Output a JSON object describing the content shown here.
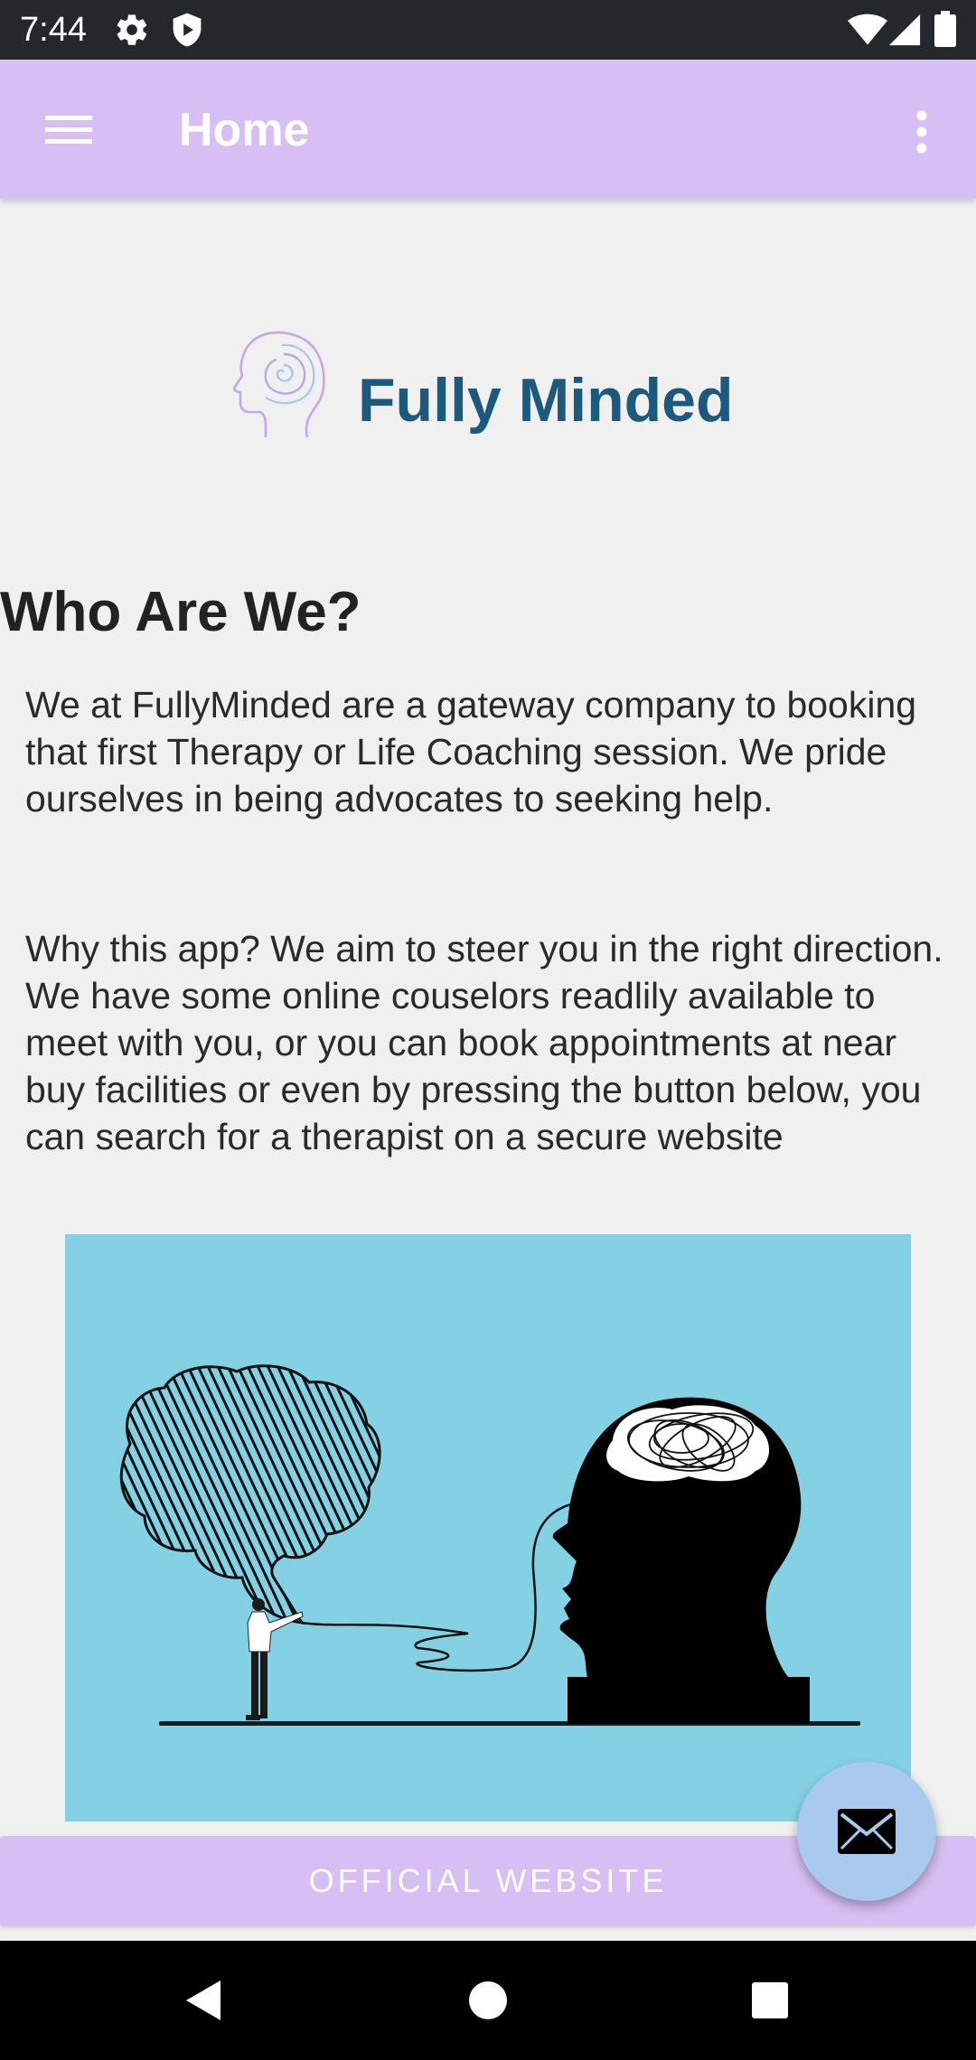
{
  "status_bar": {
    "time": "7:44",
    "icons": [
      "settings-icon",
      "shield-icon",
      "wifi-icon",
      "signal-icon",
      "battery-icon"
    ]
  },
  "app_bar": {
    "title": "Home",
    "menu_icon": "hamburger-menu-icon",
    "overflow_icon": "more-vert-icon"
  },
  "logo": {
    "text": "Fully Minded",
    "icon": "head-spiral-logo-icon",
    "text_color": "#1b5a7e"
  },
  "content": {
    "heading": "Who Are We?",
    "paragraph_1": "We at FullyMinded are a gateway company to booking that first Therapy or Life Coaching session. We pride ourselves in being advocates to seeking help.",
    "paragraph_2": "Why this app? We aim to steer you in the right direction. We have some online couselors readlily available to meet with you, or you can book appointments at near buy facilities or even by pressing the button below, you can search for a therapist on a secure website",
    "illustration": "person-drawing-brain-and-head-illustration"
  },
  "website_button": {
    "label": "OFFICIAL WEBSITE"
  },
  "fab": {
    "icon": "mail-icon"
  },
  "nav_bar": {
    "icons": [
      "back-icon",
      "home-icon",
      "recents-icon"
    ]
  },
  "colors": {
    "accent": "#d7bff3",
    "fab": "#aac9ef",
    "illustration_bg": "#84d1e3",
    "status_bar": "#25282b"
  }
}
